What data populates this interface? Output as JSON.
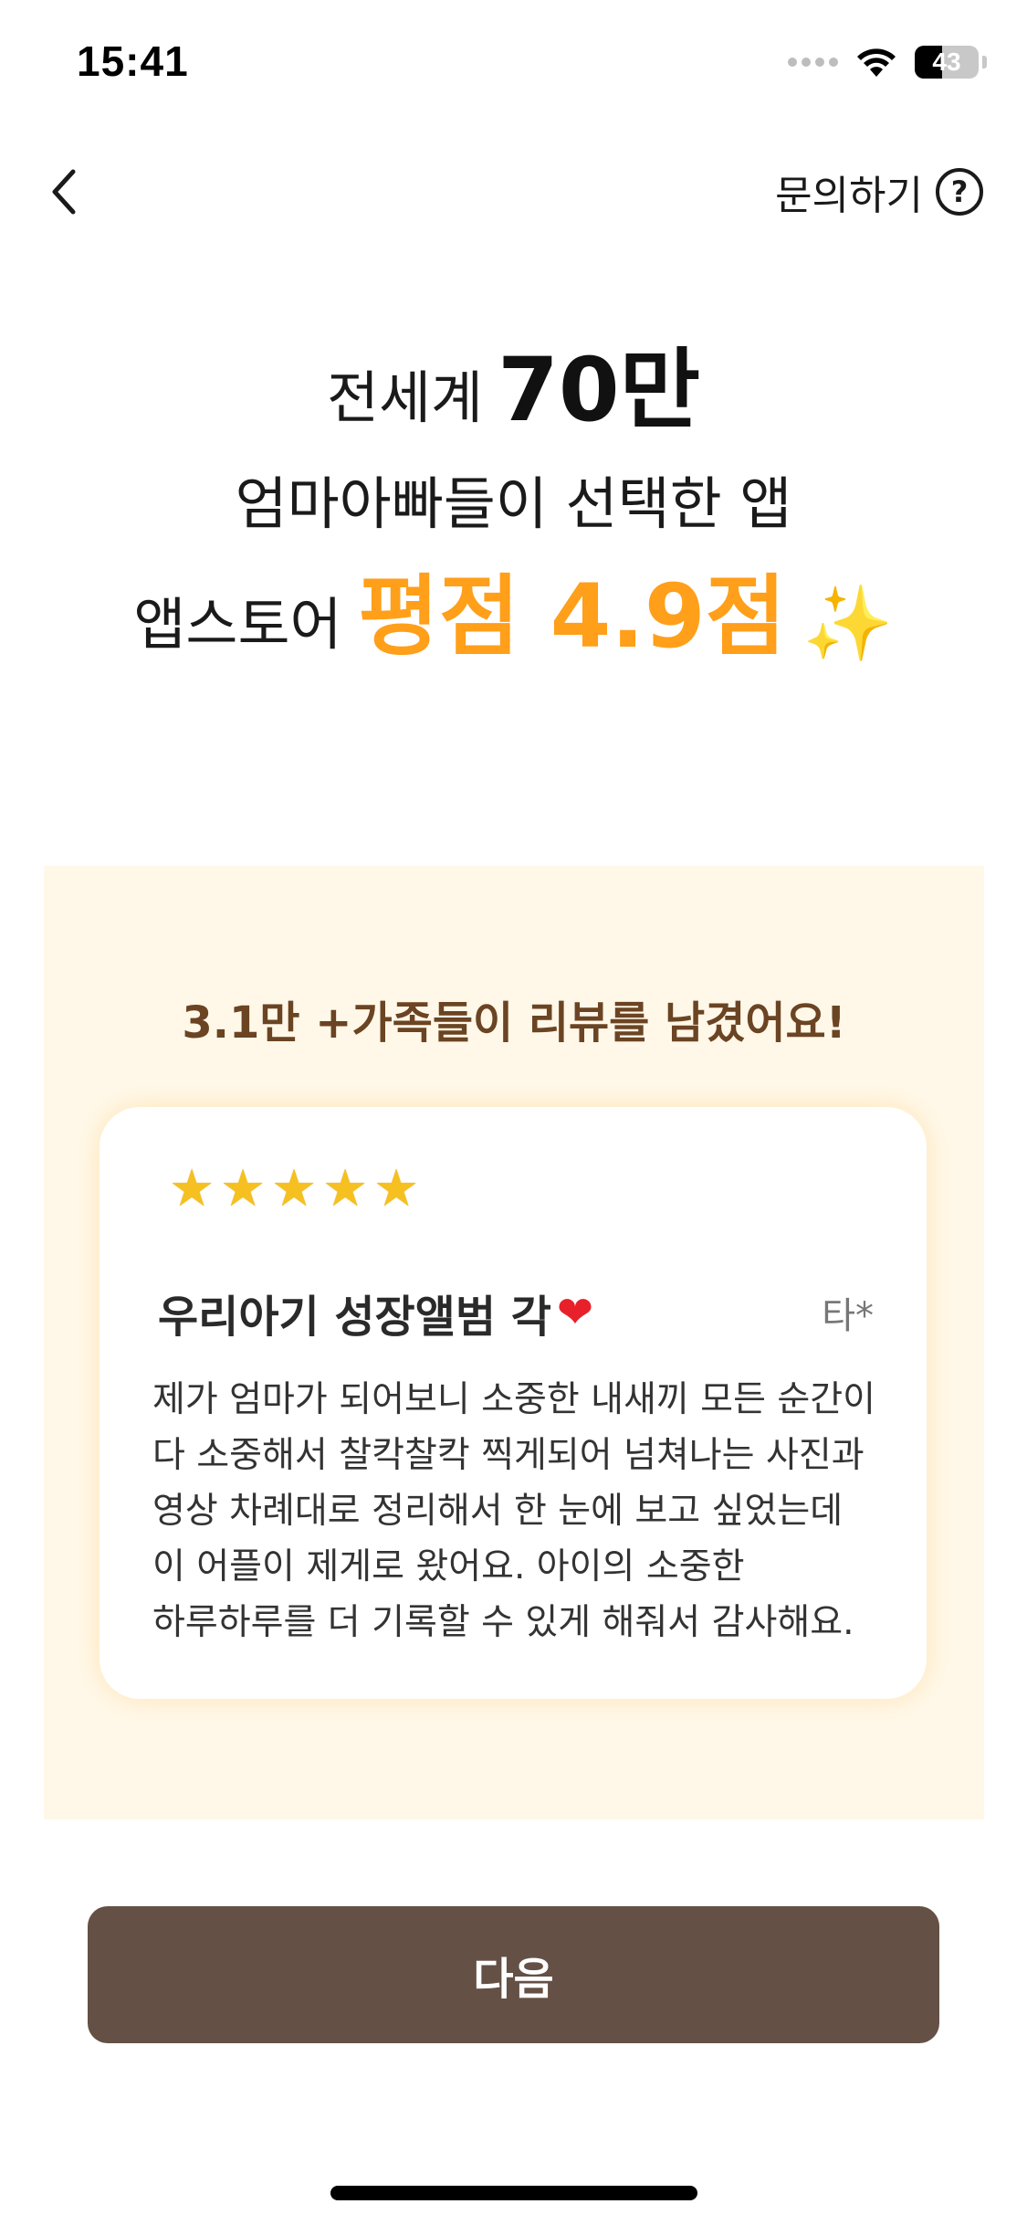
{
  "status_bar": {
    "time": "15:41",
    "battery_level": "43",
    "battery_fraction": 0.43
  },
  "nav": {
    "back_icon": "chevron-left-icon",
    "help_label": "문의하기",
    "help_icon": "question-circle-icon"
  },
  "headline": {
    "line1_prefix": "전세계",
    "line1_highlight": "70만",
    "line2": "엄마아빠들이 선택한 앱",
    "line3_prefix": "앱스토어",
    "line3_highlight": "평점 4.9점",
    "sparkle": "✨"
  },
  "review_section": {
    "count_text": "3.1만 +가족들이 리뷰를 남겼어요!",
    "card": {
      "rating": 5,
      "stars": [
        "★",
        "★",
        "★",
        "★",
        "★"
      ],
      "title": "우리아기 성장앨범 각",
      "title_emoji": "❤",
      "reviewer": "타*",
      "body_lines": [
        "제가 엄마가 되어보니 소중한 내새끼 모든 순간이",
        "다 소중해서 찰칵찰칵 찍게되어 넘쳐나는 사진과",
        "영상 차례대로 정리해서 한 눈에 보고 싶었는데",
        "이 어플이 제게로 왔어요. 아이의 소중한",
        "하루하루를 더 기록할 수 있게 해줘서 감사해요."
      ]
    }
  },
  "footer": {
    "next_label": "다음"
  },
  "colors": {
    "accent_orange": "#ff9f1a",
    "panel_bg": "#fff8e9",
    "count_text": "#6b4423",
    "button_bg": "#645045",
    "star": "#f5c020"
  }
}
